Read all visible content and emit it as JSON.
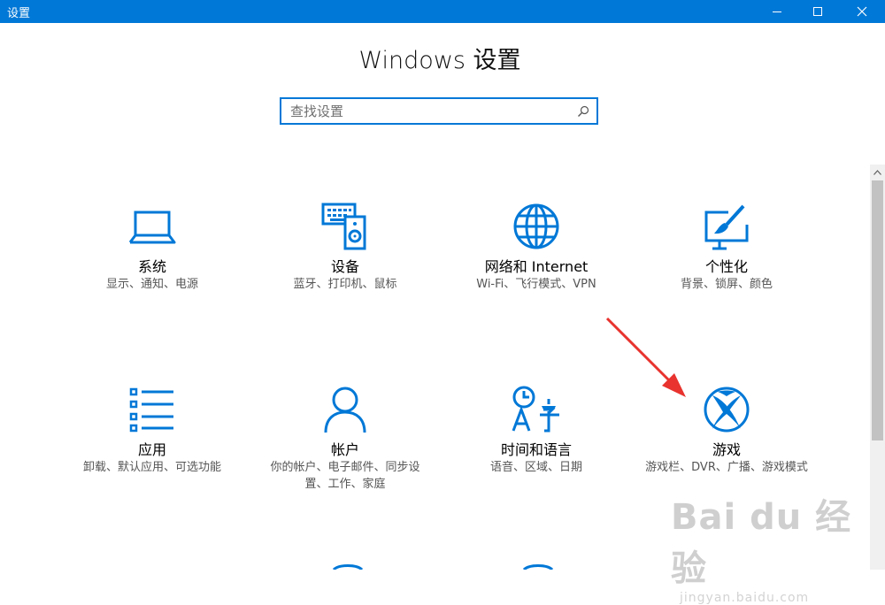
{
  "window": {
    "title": "设置"
  },
  "heading": "Windows 设置",
  "search": {
    "placeholder": "查找设置",
    "value": ""
  },
  "tiles": [
    {
      "name": "系统",
      "desc": "显示、通知、电源",
      "icon": "laptop-icon"
    },
    {
      "name": "设备",
      "desc": "蓝牙、打印机、鼠标",
      "icon": "keyboard-speaker-icon"
    },
    {
      "name": "网络和 Internet",
      "desc": "Wi-Fi、飞行模式、VPN",
      "icon": "globe-icon"
    },
    {
      "name": "个性化",
      "desc": "背景、锁屏、颜色",
      "icon": "paint-icon"
    },
    {
      "name": "应用",
      "desc": "卸载、默认应用、可选功能",
      "icon": "app-list-icon"
    },
    {
      "name": "帐户",
      "desc": "你的帐户、电子邮件、同步设置、工作、家庭",
      "icon": "person-icon"
    },
    {
      "name": "时间和语言",
      "desc": "语音、区域、日期",
      "icon": "time-language-icon"
    },
    {
      "name": "游戏",
      "desc": "游戏栏、DVR、广播、游戏模式",
      "icon": "xbox-icon"
    }
  ],
  "watermark": {
    "brand": "Bai du 经验",
    "url": "jingyan.baidu.com"
  },
  "colors": {
    "accent": "#0078d7",
    "annotation": "#e8332e"
  }
}
